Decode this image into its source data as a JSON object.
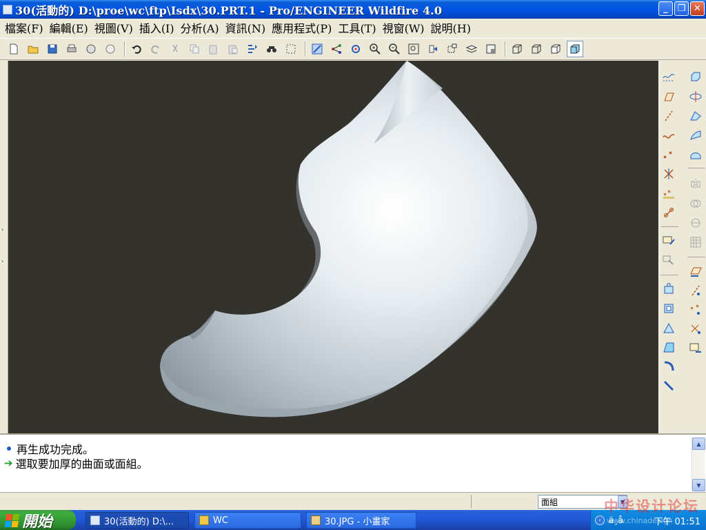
{
  "window": {
    "title": "30(活動的) D:\\proe\\wc\\ftp\\Isdx\\30.PRT.1 - Pro/ENGINEER Wildfire 4.0",
    "controls": [
      "minimize",
      "restore",
      "close"
    ]
  },
  "menu": {
    "items": [
      "檔案(F)",
      "編輯(E)",
      "視圖(V)",
      "插入(I)",
      "分析(A)",
      "資訊(N)",
      "應用程式(P)",
      "工具(T)",
      "視窗(W)",
      "說明(H)"
    ]
  },
  "toolbar": {
    "icons": [
      "new-file-icon",
      "open-file-icon",
      "save-icon",
      "print-icon",
      "mail-icon",
      "send-icon",
      "undo-icon",
      "redo-icon",
      "cut-icon",
      "copy-icon",
      "paste-icon",
      "paste-special-icon",
      "regenerate-icon",
      "find-icon",
      "select-box-icon",
      "repaint-icon",
      "orient-icon",
      "spin-center-icon",
      "zoom-in-icon",
      "zoom-out-icon",
      "refit-icon",
      "view-manager-icon",
      "saved-views-icon",
      "layers-icon",
      "appearance-icon",
      "wireframe-icon",
      "hidden-line-icon",
      "no-hidden-icon",
      "shading-icon"
    ]
  },
  "viewport": {
    "background": "#34322c",
    "model_color": "#cfd8de"
  },
  "messages": [
    {
      "type": "info",
      "text": "再生成功完成。"
    },
    {
      "type": "prompt",
      "text": "選取要加厚的曲面或面組。"
    }
  ],
  "status": {
    "filter_value": "面組"
  },
  "taskbar": {
    "start_label": "開始",
    "tasks": [
      {
        "label": "30(活動的) D:\\...",
        "active": true
      },
      {
        "label": "WC",
        "active": false
      },
      {
        "label": "30.JPG - 小畫家",
        "active": false
      }
    ],
    "tray_text": "ä¸­å",
    "clock": "下午 01:51"
  },
  "watermark": {
    "text": "中华设计论坛",
    "subtext": "www.chinadesign"
  }
}
